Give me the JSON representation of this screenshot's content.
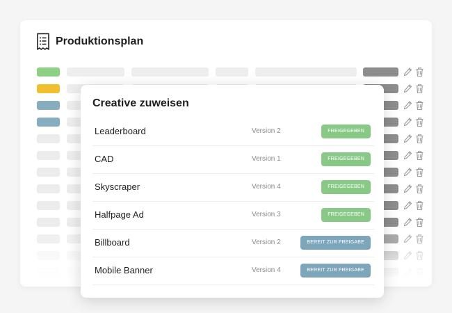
{
  "card": {
    "title": "Produktionsplan",
    "icon": "document-list-icon"
  },
  "background_rows": [
    {
      "swatch_color": "#8ccf85"
    },
    {
      "swatch_color": "#f0c030"
    },
    {
      "swatch_color": "#86aebf"
    },
    {
      "swatch_color": "#86aebf"
    },
    {
      "swatch_color": "#ececec"
    },
    {
      "swatch_color": "#ececec"
    },
    {
      "swatch_color": "#ececec"
    },
    {
      "swatch_color": "#ececec"
    },
    {
      "swatch_color": "#ececec"
    },
    {
      "swatch_color": "#ececec"
    },
    {
      "swatch_color": "#ececec"
    },
    {
      "swatch_color": "#ececec"
    },
    {
      "swatch_color": "#ececec"
    }
  ],
  "row_actions": {
    "edit_icon": "pencil-icon",
    "delete_icon": "trash-icon"
  },
  "modal": {
    "title": "Creative zuweisen",
    "items": [
      {
        "name": "Leaderboard",
        "version": "Version 2",
        "status": "FREIGEGEBEN",
        "status_color": "#88c987"
      },
      {
        "name": "CAD",
        "version": "Version 1",
        "status": "FREIGEGEBEN",
        "status_color": "#88c987"
      },
      {
        "name": "Skyscraper",
        "version": "Version 4",
        "status": "FREIGEGEBEN",
        "status_color": "#88c987"
      },
      {
        "name": "Halfpage Ad",
        "version": "Version 3",
        "status": "FREIGEGEBEN",
        "status_color": "#88c987"
      },
      {
        "name": "Billboard",
        "version": "Version 2",
        "status": "BEREIT ZUR FREIGABE",
        "status_color": "#7ea6ba"
      },
      {
        "name": "Mobile Banner",
        "version": "Version 4",
        "status": "BEREIT ZUR FREIGABE",
        "status_color": "#7ea6ba"
      }
    ]
  }
}
